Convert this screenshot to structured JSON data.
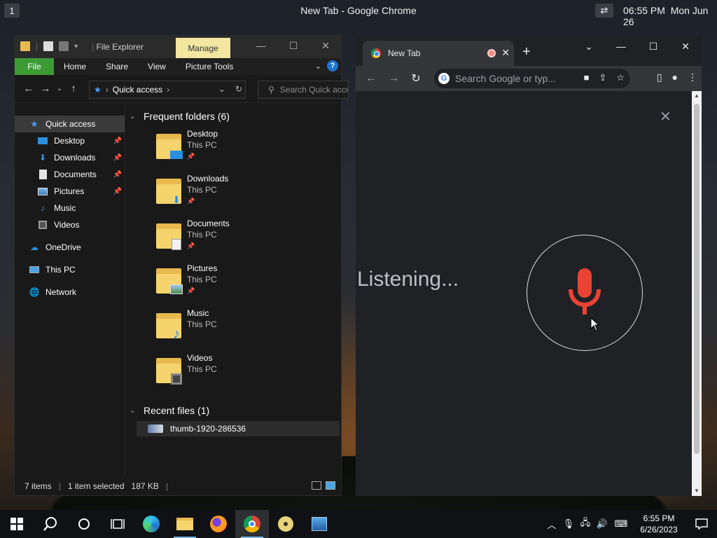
{
  "topbar": {
    "workspace": "1",
    "title": "New Tab - Google Chrome",
    "time": "06:55 PM",
    "date": "Mon Jun 26"
  },
  "explorer": {
    "title": "File Explorer",
    "manage": "Manage",
    "ribbon": {
      "file": "File",
      "home": "Home",
      "share": "Share",
      "view": "View",
      "picture_tools": "Picture Tools"
    },
    "address": "Quick access",
    "search_placeholder": "Search Quick access",
    "sidebar": {
      "quick_access": "Quick access",
      "pinned": [
        {
          "label": "Desktop"
        },
        {
          "label": "Downloads"
        },
        {
          "label": "Documents"
        },
        {
          "label": "Pictures"
        },
        {
          "label": "Music"
        },
        {
          "label": "Videos"
        }
      ],
      "onedrive": "OneDrive",
      "this_pc": "This PC",
      "network": "Network"
    },
    "frequent_header": "Frequent folders (6)",
    "folders": [
      {
        "name": "Desktop",
        "location": "This PC"
      },
      {
        "name": "Downloads",
        "location": "This PC"
      },
      {
        "name": "Documents",
        "location": "This PC"
      },
      {
        "name": "Pictures",
        "location": "This PC"
      },
      {
        "name": "Music",
        "location": "This PC"
      },
      {
        "name": "Videos",
        "location": "This PC"
      }
    ],
    "recent_header": "Recent files (1)",
    "recent_files": [
      {
        "name": "thumb-1920-286536"
      }
    ],
    "status": {
      "items": "7 items",
      "selected": "1 item selected",
      "size": "187 KB"
    }
  },
  "chrome": {
    "tab_title": "New Tab",
    "omnibox_placeholder": "Search Google or typ...",
    "listening": "Listening...",
    "colors": {
      "mic": "#ea4335"
    }
  },
  "taskbar": {
    "time": "6:55 PM",
    "date": "6/26/2023"
  }
}
